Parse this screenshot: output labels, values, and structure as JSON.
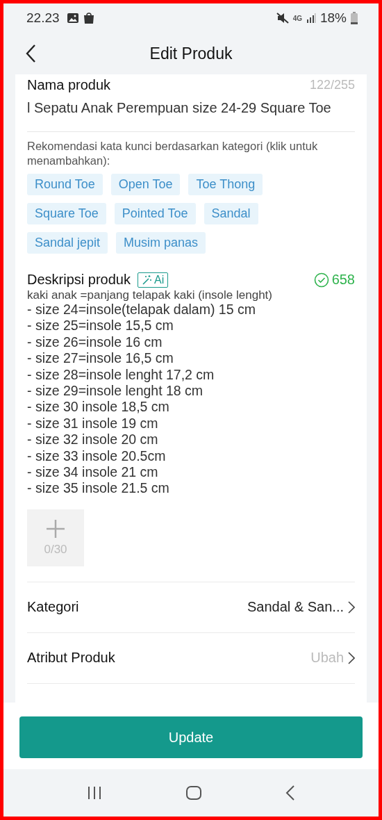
{
  "status_bar": {
    "time": "22.23",
    "network": "4G",
    "battery": "18%"
  },
  "header": {
    "title": "Edit Produk"
  },
  "product_name": {
    "label": "Nama produk",
    "counter": "122/255",
    "value": "l Sepatu Anak Perempuan size 24-29 Square Toe"
  },
  "keywords": {
    "hint": "Rekomendasi kata kunci berdasarkan kategori (klik untuk menambahkan):",
    "tags": [
      "Round Toe",
      "Open Toe",
      "Toe Thong",
      "Square Toe",
      "Pointed Toe",
      "Sandal",
      "Sandal jepit",
      "Musim panas"
    ]
  },
  "description": {
    "label": "Deskripsi produk",
    "ai_badge": "Ai",
    "count": "658",
    "lines": [
      "kaki anak =panjang telapak kaki (insole lenght)",
      "- size 24=insole(telapak dalam) 15 cm",
      "- size 25=insole 15,5 cm",
      "- size 26=insole 16 cm",
      "- size 27=insole 16,5 cm",
      "- size 28=insole lenght 17,2 cm",
      "- size 29=insole lenght 18 cm",
      "- size 30 insole 18,5 cm",
      "- size 31 insole 19 cm",
      "- size 32 insole 20 cm",
      "- size 33 insole 20.5cm",
      "- size 34 insole 21 cm",
      "- size 35 insole 21.5 cm"
    ]
  },
  "media": {
    "counter": "0/30"
  },
  "rows": [
    {
      "label": "Kategori",
      "value": "Sandal & San...",
      "muted": false
    },
    {
      "label": "Atribut Produk",
      "value": "Ubah",
      "muted": true
    }
  ],
  "buttons": [
    "Update"
  ]
}
